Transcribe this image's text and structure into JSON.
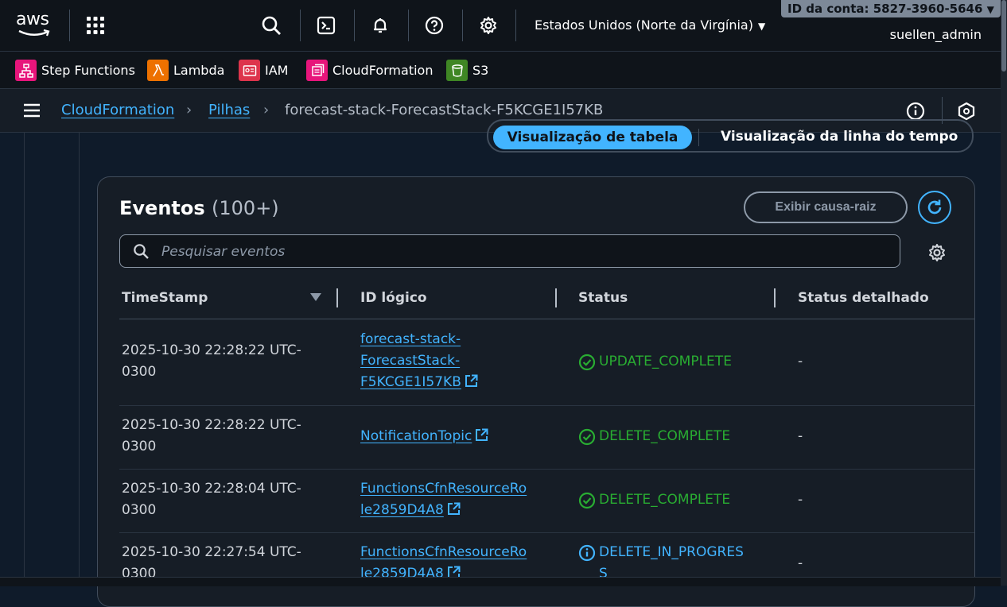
{
  "topnav": {
    "logo_text": "aws",
    "region": "Estados Unidos (Norte da Virgínia)",
    "account_badge": "ID da conta: 5827-3960-5646",
    "username": "suellen_admin",
    "icons": [
      "grid-icon",
      "search-icon",
      "cloudshell-icon",
      "bell-icon",
      "help-icon",
      "settings-icon"
    ]
  },
  "favorites": [
    {
      "label": "Step Functions",
      "color": "#e7157b",
      "icon": "step-functions-icon"
    },
    {
      "label": "Lambda",
      "color": "#ed7100",
      "icon": "lambda-icon"
    },
    {
      "label": "IAM",
      "color": "#dd344c",
      "icon": "iam-icon"
    },
    {
      "label": "CloudFormation",
      "color": "#e7157b",
      "icon": "cloudformation-icon"
    },
    {
      "label": "S3",
      "color": "#3f8624",
      "icon": "s3-icon"
    }
  ],
  "breadcrumb": {
    "items": [
      "CloudFormation",
      "Pilhas"
    ],
    "current": "forecast-stack-ForecastStack-F5KCGE1I57KB"
  },
  "view_toggle": {
    "active": "Visualização de tabela",
    "other": "Visualização da linha do tempo"
  },
  "events": {
    "title": "Eventos",
    "count": "(100+)",
    "root_cause_button": "Exibir causa-raiz",
    "search_placeholder": "Pesquisar eventos",
    "columns": [
      "TimeStamp",
      "ID lógico",
      "Status",
      "Status detalhado"
    ],
    "rows": [
      {
        "timestamp": "2025-10-30 22:28:22 UTC-\n0300",
        "logical_id": "forecast-stack-\nForecastStack-\nF5KCGE1I57KB",
        "status": "UPDATE_COMPLETE",
        "status_kind": "ok",
        "detail": "-"
      },
      {
        "timestamp": "2025-10-30 22:28:22 UTC-\n0300",
        "logical_id": "NotificationTopic",
        "status": "DELETE_COMPLETE",
        "status_kind": "ok",
        "detail": "-"
      },
      {
        "timestamp": "2025-10-30 22:28:04 UTC-\n0300",
        "logical_id": "FunctionsCfnResourceRo\nle2859D4A8",
        "status": "DELETE_COMPLETE",
        "status_kind": "ok",
        "detail": "-"
      },
      {
        "timestamp": "2025-10-30 22:27:54 UTC-\n0300",
        "logical_id": "FunctionsCfnResourceRo\nle2859D4A8",
        "status": "DELETE_IN_PROGRES\nS",
        "status_kind": "progress",
        "detail": "-"
      }
    ]
  }
}
